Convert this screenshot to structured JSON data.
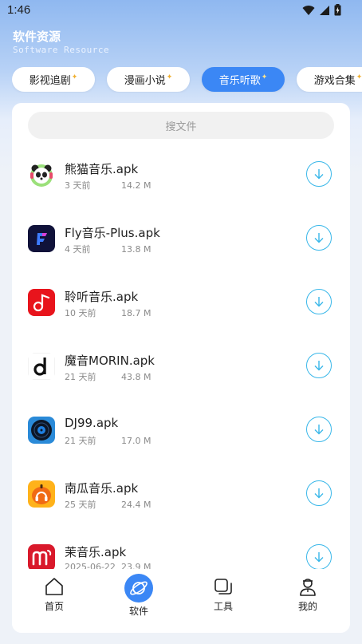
{
  "status_bar": {
    "time": "1:46"
  },
  "header": {
    "title": "软件资源",
    "subtitle": "Software Resource"
  },
  "categories": [
    {
      "label": "影视追剧",
      "active": false
    },
    {
      "label": "漫画小说",
      "active": false
    },
    {
      "label": "音乐听歌",
      "active": true
    },
    {
      "label": "游戏合集",
      "active": false
    }
  ],
  "search": {
    "placeholder": "搜文件"
  },
  "files": [
    {
      "name": "熊猫音乐.apk",
      "date": "3 天前",
      "size": "14.2 M",
      "icon": "panda-music-icon"
    },
    {
      "name": "Fly音乐-Plus.apk",
      "date": "4 天前",
      "size": "13.8 M",
      "icon": "fly-music-icon"
    },
    {
      "name": "聆听音乐.apk",
      "date": "10 天前",
      "size": "18.7 M",
      "icon": "lingting-music-icon"
    },
    {
      "name": "魔音MORIN.apk",
      "date": "21 天前",
      "size": "43.8 M",
      "icon": "morin-icon"
    },
    {
      "name": "DJ99.apk",
      "date": "21 天前",
      "size": "17.0 M",
      "icon": "dj99-icon"
    },
    {
      "name": "南瓜音乐.apk",
      "date": "25 天前",
      "size": "24.4 M",
      "icon": "pumpkin-music-icon"
    },
    {
      "name": "茉音乐.apk",
      "date": "2025-06-22",
      "size": "23.9 M",
      "icon": "mo-music-icon"
    }
  ],
  "bottom_nav": [
    {
      "label": "首页",
      "icon": "home-icon",
      "active": false
    },
    {
      "label": "软件",
      "icon": "planet-icon",
      "active": true
    },
    {
      "label": "工具",
      "icon": "tools-icon",
      "active": false
    },
    {
      "label": "我的",
      "icon": "profile-icon",
      "active": false
    }
  ],
  "colors": {
    "accent": "#3b87f5",
    "download": "#39b7e9"
  }
}
